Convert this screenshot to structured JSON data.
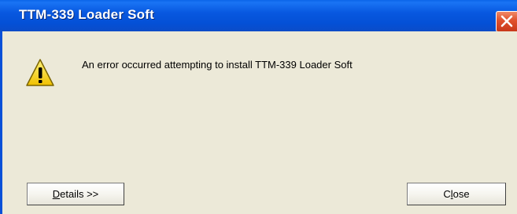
{
  "window": {
    "title": "TTM-339 Loader Soft"
  },
  "dialog": {
    "icon": "warning-icon",
    "message": "An error occurred attempting to install TTM-339 Loader Soft"
  },
  "buttons": {
    "details": {
      "mnemonic": "D",
      "rest": "etails >>"
    },
    "close": {
      "before": "C",
      "mnemonic": "l",
      "rest": "ose"
    }
  },
  "colors": {
    "title_bar": "#0858e0",
    "client_background": "#ece9d8",
    "close_button": "#e0502c",
    "warning_yellow": "#f7d51a"
  }
}
